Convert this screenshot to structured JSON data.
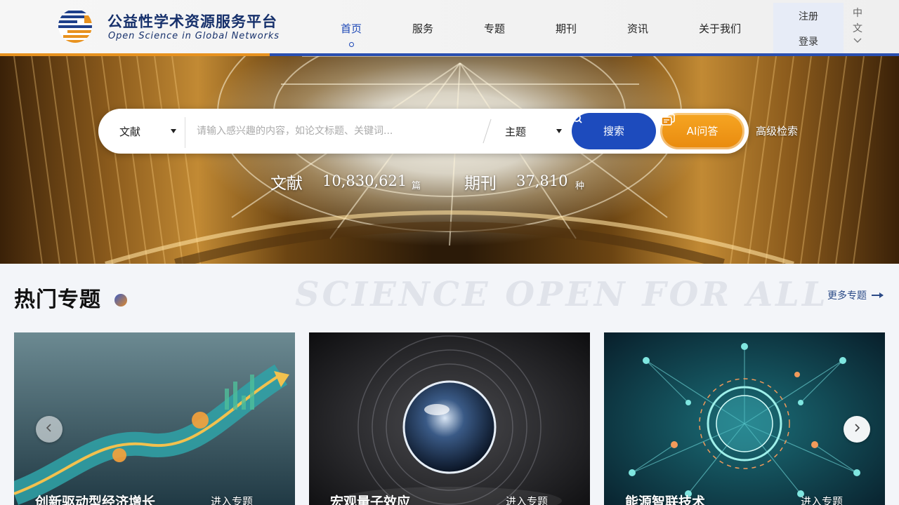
{
  "logo": {
    "title_cn": "公益性学术资源服务平台",
    "title_en": "Open Science in Global Networks"
  },
  "nav": {
    "items": [
      {
        "label": "首页",
        "active": true
      },
      {
        "label": "服务",
        "active": false
      },
      {
        "label": "专题",
        "active": false
      },
      {
        "label": "期刊",
        "active": false
      },
      {
        "label": "资讯",
        "active": false
      },
      {
        "label": "关于我们",
        "active": false
      }
    ],
    "register": "注册",
    "login": "登录",
    "language": {
      "line1": "中",
      "line2": "文"
    }
  },
  "search": {
    "type_select": "文献",
    "placeholder": "请输入感兴趣的内容，如论文标题、关键词...",
    "field_select": "主题",
    "search_button": "搜索",
    "ai_button": "AI问答",
    "advanced": "高级检索"
  },
  "stats": [
    {
      "label": "文献",
      "value": "10,830,621",
      "unit": "篇"
    },
    {
      "label": "期刊",
      "value": "37,810",
      "unit": "种"
    }
  ],
  "section": {
    "title": "热门专题",
    "watermark": "SCIENCE OPEN FOR ALL",
    "more": "更多专题"
  },
  "cards": [
    {
      "title": "创新驱动型经济增长",
      "link": "进入专题"
    },
    {
      "title": "宏观量子效应",
      "link": "进入专题"
    },
    {
      "title": "能源智联技术",
      "link": "进入专题"
    }
  ],
  "colors": {
    "brand_blue": "#1d4bbd",
    "accent_orange": "#e98a0e",
    "nav_active": "#1c47b6"
  },
  "icons": {
    "search": "search-icon",
    "ai": "ai-chat-icon",
    "caret": "caret-down-icon",
    "arrow": "arrow-right-icon"
  }
}
